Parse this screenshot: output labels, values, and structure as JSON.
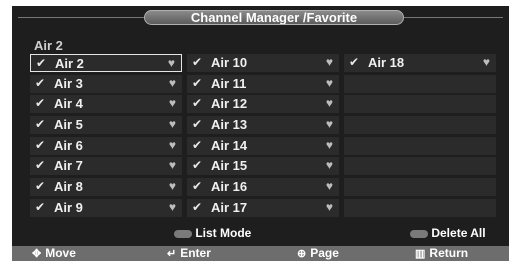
{
  "title": "Channel Manager /Favorite",
  "section_label": "Air 2",
  "columns": [
    [
      "Air 2",
      "Air 3",
      "Air 4",
      "Air 5",
      "Air 6",
      "Air 7",
      "Air 8",
      "Air 9"
    ],
    [
      "Air 10",
      "Air 11",
      "Air 12",
      "Air 13",
      "Air 14",
      "Air 15",
      "Air 16",
      "Air 17"
    ],
    [
      "Air 18",
      "",
      "",
      "",
      "",
      "",
      "",
      ""
    ]
  ],
  "selected": "Air 2",
  "legend": {
    "list_mode": "List Mode",
    "delete_all": "Delete All"
  },
  "nav": {
    "move": "Move",
    "enter": "Enter",
    "page": "Page",
    "return": "Return"
  },
  "colors": {
    "background": "#1e1e1e",
    "cell": "#2b2b2b",
    "bottom_bar": "#6d6d6d"
  },
  "icons": {
    "check": "check-icon",
    "favorite": "heart-icon",
    "move": "move-arrows-icon",
    "enter": "enter-icon",
    "page": "page-icon",
    "return": "return-icon"
  }
}
